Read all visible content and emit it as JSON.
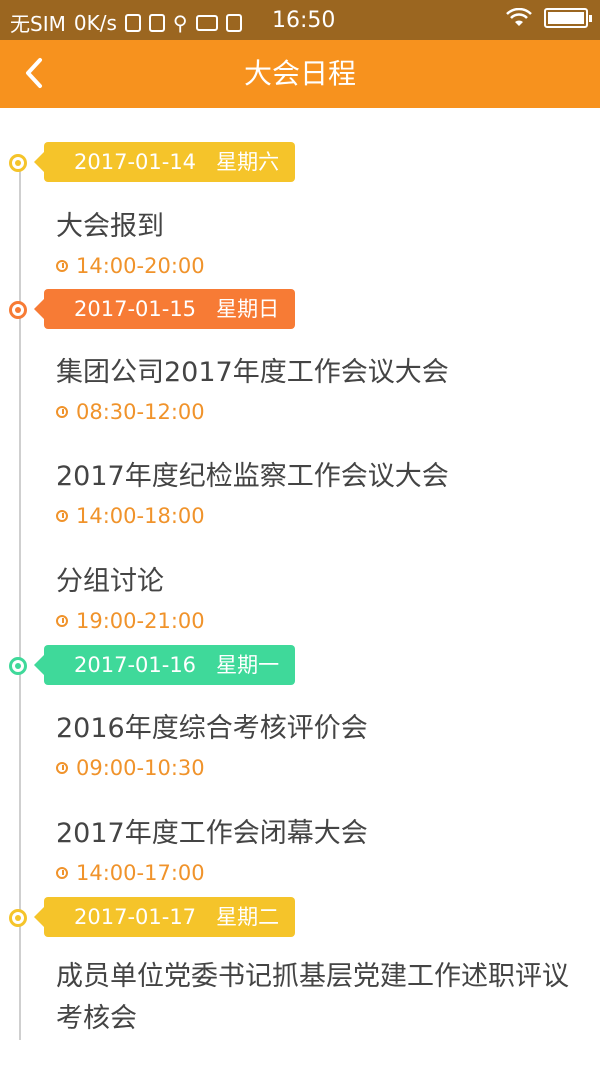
{
  "status_bar": {
    "carrier": "无SIM",
    "speed": "0K/s",
    "time": "16:50"
  },
  "nav": {
    "back_icon": "chevron-left-icon",
    "title": "大会日程"
  },
  "colors": {
    "nav": "#f7921e",
    "day1": "#f5c42a",
    "day2": "#f77b35",
    "day3": "#3fd99a",
    "day4": "#f5c42a",
    "time_text": "#f0932b"
  },
  "days": [
    {
      "date": "2017-01-14",
      "weekday": "星期六",
      "events": [
        {
          "title": "大会报到",
          "time": "14:00-20:00"
        }
      ]
    },
    {
      "date": "2017-01-15",
      "weekday": "星期日",
      "events": [
        {
          "title": "集团公司2017年度工作会议大会",
          "time": "08:30-12:00"
        },
        {
          "title": "2017年度纪检监察工作会议大会",
          "time": "14:00-18:00"
        },
        {
          "title": "分组讨论",
          "time": "19:00-21:00"
        }
      ]
    },
    {
      "date": "2017-01-16",
      "weekday": "星期一",
      "events": [
        {
          "title": "2016年度综合考核评价会",
          "time": "09:00-10:30"
        },
        {
          "title": "2017年度工作会闭幕大会",
          "time": "14:00-17:00"
        }
      ]
    },
    {
      "date": "2017-01-17",
      "weekday": "星期二",
      "events": [
        {
          "title": "成员单位党委书记抓基层党建工作述职评议考核会"
        }
      ]
    }
  ]
}
